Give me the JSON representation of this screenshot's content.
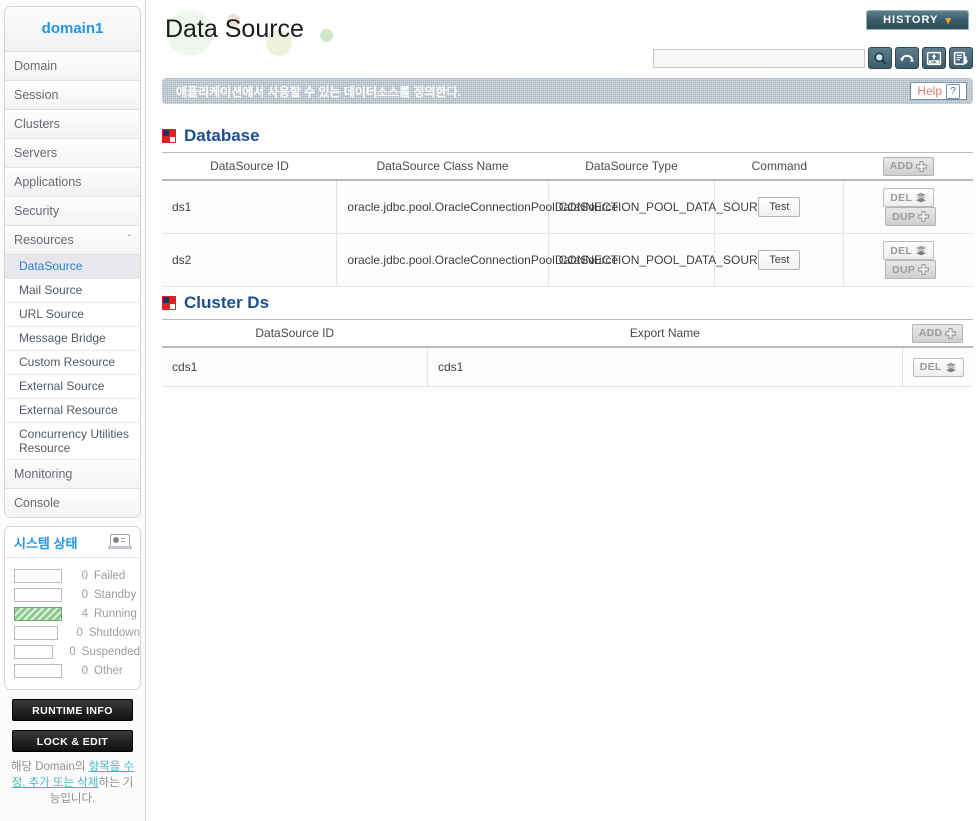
{
  "sidebar": {
    "domain_label": "domain1",
    "nav": [
      {
        "label": "Domain",
        "expandable": false
      },
      {
        "label": "Session",
        "expandable": false
      },
      {
        "label": "Clusters",
        "expandable": false
      },
      {
        "label": "Servers",
        "expandable": false
      },
      {
        "label": "Applications",
        "expandable": false
      },
      {
        "label": "Security",
        "expandable": false
      },
      {
        "label": "Resources",
        "expandable": true,
        "chevron": "ˇ"
      }
    ],
    "sub_items": [
      {
        "label": "DataSource",
        "active": true
      },
      {
        "label": "Mail Source",
        "active": false
      },
      {
        "label": "URL Source",
        "active": false
      },
      {
        "label": "Message Bridge",
        "active": false
      },
      {
        "label": "Custom Resource",
        "active": false
      },
      {
        "label": "External Source",
        "active": false
      },
      {
        "label": "External Resource",
        "active": false
      },
      {
        "label": "Concurrency Utilities Resource",
        "active": false
      }
    ],
    "nav_bottom": [
      {
        "label": "Monitoring"
      },
      {
        "label": "Console"
      }
    ],
    "system_status": {
      "title": "시스템 상태",
      "rows": [
        {
          "count": "0",
          "label": "Failed",
          "filled": false
        },
        {
          "count": "0",
          "label": "Standby",
          "filled": false
        },
        {
          "count": "4",
          "label": "Running",
          "filled": true
        },
        {
          "count": "0",
          "label": "Shutdown",
          "filled": false
        },
        {
          "count": "0",
          "label": "Suspended",
          "filled": false
        },
        {
          "count": "0",
          "label": "Other",
          "filled": false
        }
      ],
      "fill_color": "#8cc98c"
    },
    "runtime_info_label": "RUNTIME INFO",
    "lock_edit_label": "LOCK & EDIT",
    "lock_note_prefix": "해당 Domain의 ",
    "lock_note_link": "항목을 수정, 추가 또는 삭제",
    "lock_note_suffix": "하는 기능입니다."
  },
  "header": {
    "page_title": "Data Source",
    "history_label": "HISTORY",
    "history_chevron": "▾",
    "search_value": "",
    "search_placeholder": "",
    "tool_icons": [
      {
        "name": "search-icon"
      },
      {
        "name": "refresh-icon"
      },
      {
        "name": "xml-export-icon"
      },
      {
        "name": "import-download-icon"
      }
    ]
  },
  "notice": {
    "text": "애플리케이션에서 사용할 수 있는 데이터소스를 정의한다.",
    "help_label": "Help",
    "help_mark": "?"
  },
  "database_section": {
    "title": "Database",
    "add_label": "ADD",
    "columns": [
      "DataSource ID",
      "DataSource Class Name",
      "DataSource Type",
      "Command"
    ],
    "rows": [
      {
        "id": "ds1",
        "class_name": "oracle.jdbc.pool.OracleConnectionPoolDataSource",
        "type": "CONNECTION_POOL_DATA_SOURCE",
        "command_label": "Test",
        "del_label": "DEL",
        "dup_label": "DUP"
      },
      {
        "id": "ds2",
        "class_name": "oracle.jdbc.pool.OracleConnectionPoolDataSource",
        "type": "CONNECTION_POOL_DATA_SOURCE",
        "command_label": "Test",
        "del_label": "DEL",
        "dup_label": "DUP"
      }
    ]
  },
  "cluster_section": {
    "title": "Cluster Ds",
    "add_label": "ADD",
    "columns": [
      "DataSource ID",
      "Export Name"
    ],
    "rows": [
      {
        "id": "cds1",
        "export_name": "cds1",
        "del_label": "DEL"
      }
    ]
  },
  "colors": {
    "accent_blue": "#2196e8",
    "section_title": "#1c4f8e",
    "section_icon_red": "#e31e24",
    "section_icon_navy": "#16365c",
    "history_chevron": "#f2a42c",
    "running_green": "#8cc98c",
    "notice_bg": "#a8b4c0",
    "link_teal": "#4ab8c6",
    "help_text": "#e07b6a"
  }
}
